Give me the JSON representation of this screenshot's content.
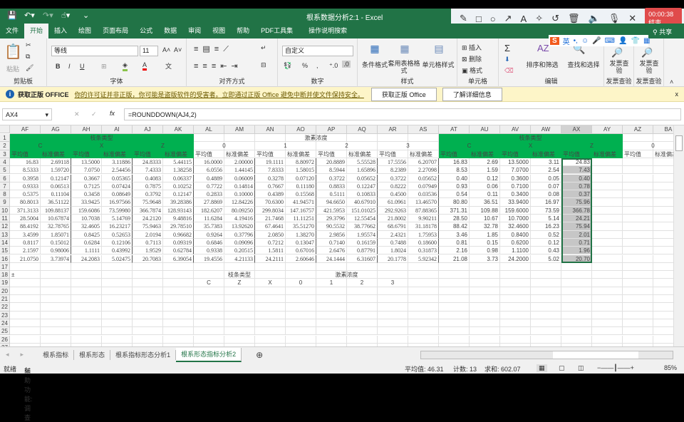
{
  "window": {
    "title": "根系数据分析2:1  -  Excel",
    "share": "共享"
  },
  "recorder": {
    "timer": "00:00:38 结束",
    "tools": [
      "pencil-icon",
      "rectangle-icon",
      "circle-icon",
      "arrow-icon",
      "text-icon",
      "highlighter-icon",
      "undo-icon",
      "trash-icon",
      "speaker-icon",
      "mic-icon",
      "close-icon"
    ]
  },
  "ime": {
    "logo": "S",
    "lang": "英",
    "punct": "•,"
  },
  "tabs": [
    "文件",
    "开始",
    "插入",
    "绘图",
    "页面布局",
    "公式",
    "数据",
    "审阅",
    "视图",
    "帮助",
    "PDF工具集",
    "操作说明搜索"
  ],
  "active_tab": "开始",
  "ribbon": {
    "clipboard": {
      "label": "剪贴板",
      "paste": "粘贴"
    },
    "font": {
      "label": "字体",
      "name": "等线",
      "size": "11",
      "bold": "B",
      "italic": "I",
      "underline": "U"
    },
    "alignment": {
      "label": "对齐方式"
    },
    "number": {
      "label": "数字",
      "format": "自定义",
      "percent": "%",
      "comma": ","
    },
    "styles": {
      "label": "样式",
      "conditional": "条件格式",
      "table": "套用表格格式",
      "cell": "单元格样式"
    },
    "cells": {
      "label": "单元格",
      "insert": "插入",
      "delete": "删除",
      "format": "格式"
    },
    "editing": {
      "label": "编辑",
      "sort": "排序和筛选",
      "find": "查找和选择"
    },
    "invoice1": {
      "label": "发票查验",
      "button": "发票查验"
    },
    "invoice2": {
      "label": "发票查验",
      "button": "发票查验"
    }
  },
  "infobar": {
    "title": "获取正版 OFFICE",
    "message": "你的许可证并非正版，你可能是盗版软件的受害者。立即通过正版 Office 避免中断并使文件保持安全。",
    "btn1": "获取正版 Office",
    "btn2": "了解详细信息",
    "close": "x"
  },
  "formula_bar": {
    "name_box": "AX4",
    "formula": "=ROUNDDOWN(AJ4,2)",
    "fx": "fx"
  },
  "columns": [
    "AF",
    "AG",
    "AH",
    "AI",
    "AJ",
    "AK",
    "AL",
    "AM",
    "AN",
    "AO",
    "AP",
    "AQ",
    "AR",
    "AS",
    "AT",
    "AU",
    "AV",
    "AW",
    "AX",
    "AY",
    "AZ",
    "BA"
  ],
  "selected_column": "AX",
  "header_rows": {
    "row1": [
      {
        "text": "枝条类型",
        "start": 0,
        "span": 6,
        "green": true
      },
      {
        "text": "激素浓度",
        "start": 6,
        "span": 8,
        "green": false
      },
      {
        "text": "枝条类型",
        "start": 14,
        "span": 6,
        "green": true
      }
    ],
    "row2": [
      {
        "text": "C",
        "start": 0,
        "span": 2,
        "green": true
      },
      {
        "text": "X",
        "start": 2,
        "span": 2,
        "green": true
      },
      {
        "text": "Z",
        "start": 4,
        "span": 2,
        "green": true
      },
      {
        "text": "0",
        "start": 6,
        "span": 2
      },
      {
        "text": "1",
        "start": 8,
        "span": 2
      },
      {
        "text": "2",
        "start": 10,
        "span": 2
      },
      {
        "text": "3",
        "start": 12,
        "span": 2
      },
      {
        "text": "C",
        "start": 14,
        "span": 2,
        "green": true
      },
      {
        "text": "X",
        "start": 16,
        "span": 2,
        "green": true
      },
      {
        "text": "Z",
        "start": 18,
        "span": 2,
        "green": true
      },
      {
        "text": "0",
        "start": 20,
        "span": 2
      }
    ],
    "row3_labels": [
      "平均值",
      "标准偏差"
    ]
  },
  "rows": [
    [
      "16.83",
      "2.69118",
      "13.5000",
      "3.11886",
      "24.8333",
      "5.44115",
      "16.0000",
      "2.00000",
      "19.1111",
      "8.80972",
      "20.8889",
      "5.55528",
      "17.5556",
      "6.20707",
      "16.83",
      "2.69",
      "13.5000",
      "3.11",
      "24.83"
    ],
    [
      "8.5333",
      "1.59720",
      "7.0750",
      "2.54456",
      "7.4333",
      "1.38258",
      "6.0556",
      "1.44145",
      "7.8333",
      "1.58015",
      "8.5944",
      "1.65896",
      "8.2389",
      "2.27098",
      "8.53",
      "1.59",
      "7.0700",
      "2.54",
      "7.43"
    ],
    [
      "0.3958",
      "0.12147",
      "0.3667",
      "0.05365",
      "0.4083",
      "0.06337",
      "0.4889",
      "0.06009",
      "0.3278",
      "0.07120",
      "0.3722",
      "0.05652",
      "0.3722",
      "0.05652",
      "0.40",
      "0.12",
      "0.3600",
      "0.05",
      "0.40"
    ],
    [
      "0.9333",
      "0.06513",
      "0.7125",
      "0.07424",
      "0.7875",
      "0.10252",
      "0.7722",
      "0.14814",
      "0.7667",
      "0.11180",
      "0.8833",
      "0.12247",
      "0.8222",
      "0.07949",
      "0.93",
      "0.06",
      "0.7100",
      "0.07",
      "0.78"
    ],
    [
      "0.5375",
      "0.11104",
      "0.3458",
      "0.08649",
      "0.3792",
      "0.12147",
      "0.2833",
      "0.10000",
      "0.4389",
      "0.15568",
      "0.5111",
      "0.10833",
      "0.4500",
      "0.03536",
      "0.54",
      "0.11",
      "0.3400",
      "0.08",
      "0.37"
    ],
    [
      "80.8013",
      "36.51122",
      "33.9425",
      "16.97566",
      "75.9648",
      "39.28386",
      "27.8869",
      "12.84226",
      "70.6300",
      "41.94571",
      "94.6650",
      "40.67910",
      "61.0961",
      "13.46570",
      "80.80",
      "36.51",
      "33.9400",
      "16.97",
      "75.96"
    ],
    [
      "371.3133",
      "109.88137",
      "159.6086",
      "73.59980",
      "366.7874",
      "128.93143",
      "182.6207",
      "80.09250",
      "299.8034",
      "147.16757",
      "421.5953",
      "151.01025",
      "292.9263",
      "87.88365",
      "371.31",
      "109.88",
      "159.6000",
      "73.59",
      "366.78"
    ],
    [
      "28.5004",
      "10.67874",
      "10.7038",
      "5.14769",
      "24.2120",
      "9.48816",
      "11.6284",
      "4.19416",
      "21.7468",
      "11.11251",
      "29.3796",
      "12.55454",
      "21.8002",
      "9.90211",
      "28.50",
      "10.67",
      "10.7000",
      "5.14",
      "24.21"
    ],
    [
      "88.4192",
      "32.78765",
      "32.4605",
      "16.23217",
      "75.9463",
      "29.78510",
      "35.7383",
      "13.92620",
      "67.4641",
      "35.51270",
      "90.5532",
      "38.77662",
      "68.6791",
      "31.18178",
      "88.42",
      "32.78",
      "32.4600",
      "16.23",
      "75.94"
    ],
    [
      "3.4599",
      "1.85071",
      "0.8425",
      "0.52653",
      "2.0194",
      "0.96682",
      "0.9264",
      "0.37796",
      "2.0850",
      "1.38270",
      "2.9856",
      "1.95574",
      "2.4321",
      "1.75953",
      "3.46",
      "1.85",
      "0.8400",
      "0.52",
      "2.01"
    ],
    [
      "0.8117",
      "0.15012",
      "0.6284",
      "0.12106",
      "0.7113",
      "0.09319",
      "0.6846",
      "0.09096",
      "0.7212",
      "0.13047",
      "0.7140",
      "0.16159",
      "0.7488",
      "0.18600",
      "0.81",
      "0.15",
      "0.6200",
      "0.12",
      "0.71"
    ],
    [
      "2.1597",
      "0.98006",
      "1.1111",
      "0.43992",
      "1.9529",
      "0.62784",
      "0.9338",
      "0.20515",
      "1.5811",
      "0.67016",
      "2.6476",
      "0.87791",
      "1.8024",
      "0.31873",
      "2.16",
      "0.98",
      "1.1100",
      "0.43",
      "1.96"
    ],
    [
      "21.0750",
      "3.73974",
      "24.2083",
      "5.02475",
      "20.7083",
      "6.39054",
      "19.4556",
      "4.21133",
      "24.2111",
      "2.60646",
      "24.1444",
      "6.31607",
      "20.1778",
      "5.92342",
      "21.08",
      "3.73",
      "24.2000",
      "5.02",
      "20.70"
    ]
  ],
  "row18": {
    "plusminus": "±",
    "branch_type": "枝条类型",
    "hormone": "激素浓度"
  },
  "row19": [
    "C",
    "Z",
    "X",
    "0",
    "1",
    "2",
    "3"
  ],
  "sheets": [
    "根系指标",
    "根系形态",
    "根系指标形态分析1",
    "根系形态指标分析2"
  ],
  "active_sheet": "根系形态指标分析2",
  "status": {
    "ready": "就绪",
    "accessibility": "辅助功能: 调查",
    "average": "平均值: 46.31",
    "count": "计数: 13",
    "sum": "求和: 602.07",
    "zoom": "85%"
  },
  "colors": {
    "excel_green": "#217346",
    "header_fill": "#00b050",
    "selection": "#c6c6c6"
  }
}
